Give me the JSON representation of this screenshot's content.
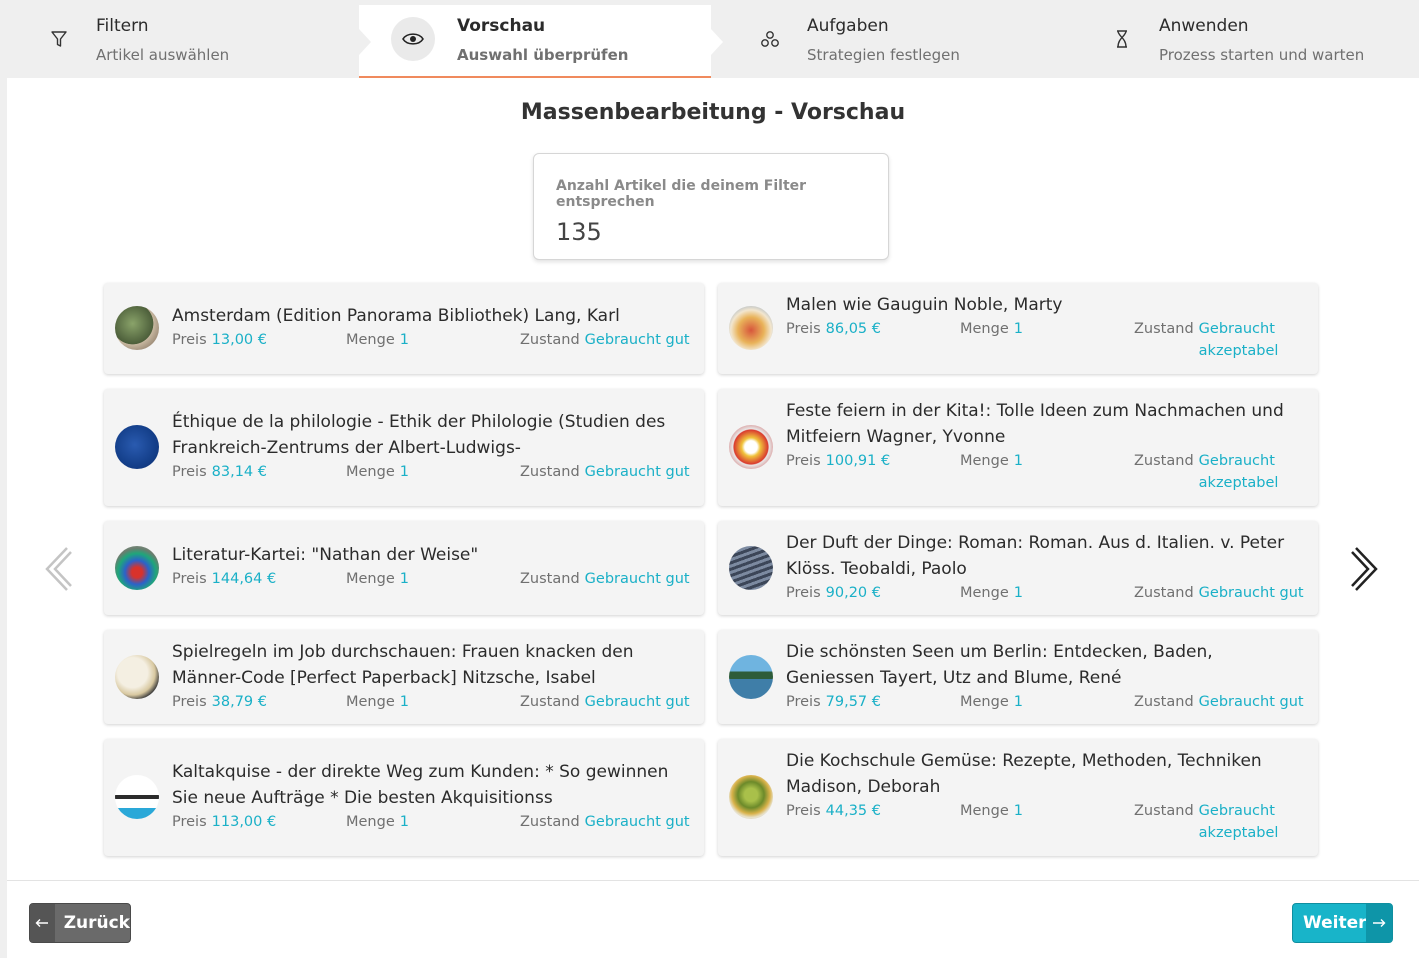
{
  "steps": [
    {
      "title": "Filtern",
      "subtitle": "Artikel auswählen",
      "icon": "filter-icon"
    },
    {
      "title": "Vorschau",
      "subtitle": "Auswahl überprüfen",
      "icon": "eye-icon"
    },
    {
      "title": "Aufgaben",
      "subtitle": "Strategien festlegen",
      "icon": "tasks-icon"
    },
    {
      "title": "Anwenden",
      "subtitle": "Prozess starten und warten",
      "icon": "hourglass-icon"
    }
  ],
  "page": {
    "title": "Massenbearbeitung - Vorschau"
  },
  "count": {
    "label": "Anzahl Artikel die deinem Filter entsprechen",
    "value": "135"
  },
  "labels": {
    "price": "Preis",
    "quantity": "Menge",
    "condition": "Zustand"
  },
  "items": [
    {
      "title": "Amsterdam (Edition Panorama Bibliothek) Lang, Karl",
      "price": "13,00 €",
      "qty": "1",
      "condition": "Gebraucht gut"
    },
    {
      "title": "Malen wie Gauguin Noble, Marty",
      "price": "86,05 €",
      "qty": "1",
      "condition": "Gebraucht akzeptabel"
    },
    {
      "title": "Éthique de la philologie - Ethik der Philologie (Studien des Frankreich-Zentrums der Albert-Ludwigs-",
      "price": "83,14 €",
      "qty": "1",
      "condition": "Gebraucht gut"
    },
    {
      "title": "Feste feiern in der Kita!: Tolle Ideen zum Nachmachen und Mitfeiern Wagner, Yvonne",
      "price": "100,91 €",
      "qty": "1",
      "condition": "Gebraucht akzeptabel"
    },
    {
      "title": "Literatur-Kartei: \"Nathan der Weise\"",
      "price": "144,64 €",
      "qty": "1",
      "condition": "Gebraucht gut"
    },
    {
      "title": "Der Duft der Dinge: Roman: Roman. Aus d. Italien. v. Peter Klöss. Teobaldi, Paolo",
      "price": "90,20 €",
      "qty": "1",
      "condition": "Gebraucht gut"
    },
    {
      "title": "Spielregeln im Job durchschauen: Frauen knacken den Männer-Code [Perfect Paperback] Nitzsche, Isabel",
      "price": "38,79 €",
      "qty": "1",
      "condition": "Gebraucht gut"
    },
    {
      "title": "Die schönsten Seen um Berlin: Entdecken, Baden, Geniessen Tayert, Utz and Blume, René",
      "price": "79,57 €",
      "qty": "1",
      "condition": "Gebraucht gut"
    },
    {
      "title": "Kaltakquise - der direkte Weg zum Kunden: * So gewinnen Sie neue Aufträge * Die besten Akquisitionss",
      "price": "113,00 €",
      "qty": "1",
      "condition": "Gebraucht gut"
    },
    {
      "title": "Die Kochschule Gemüse: Rezepte, Methoden, Techniken Madison, Deborah",
      "price": "44,35 €",
      "qty": "1",
      "condition": "Gebraucht akzeptabel"
    }
  ],
  "buttons": {
    "back": "Zurück",
    "next": "Weiter"
  },
  "colors": {
    "accent": "#1ab0c7",
    "active_underline": "#f08a5d",
    "back_button": "#6a6a6a"
  }
}
